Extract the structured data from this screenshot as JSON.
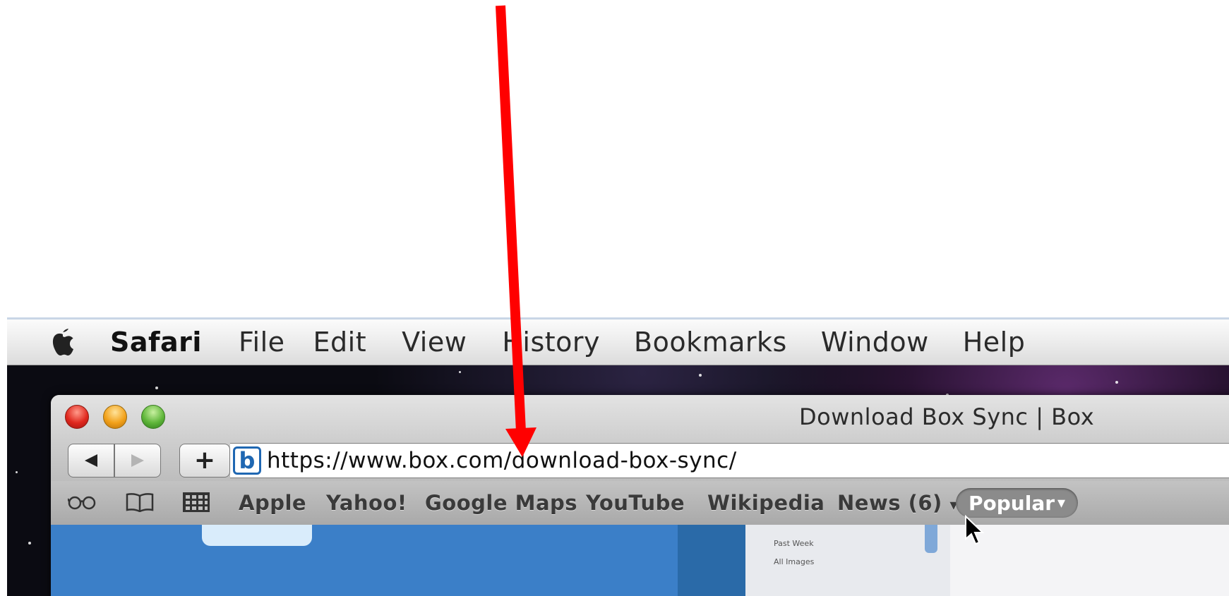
{
  "menubar": {
    "app_name": "Safari",
    "items": [
      "File",
      "Edit",
      "View",
      "History",
      "Bookmarks",
      "Window",
      "Help"
    ]
  },
  "window": {
    "title": "Download Box Sync | Box"
  },
  "toolbar": {
    "back_icon": "back-arrow-icon",
    "forward_icon": "forward-arrow-icon",
    "add_label": "+",
    "favicon_letter": "b",
    "url": "https://www.box.com/download-box-sync/"
  },
  "bookmarks": {
    "items": [
      "Apple",
      "Yahoo!",
      "Google Maps",
      "YouTube",
      "Wikipedia",
      "News (6)"
    ],
    "popular_label": "Popular",
    "dropdown_glyph": "▾"
  },
  "page_panel": {
    "rows": [
      "Past Week",
      "All Images"
    ]
  },
  "colors": {
    "annotation_arrow": "#ff0000",
    "page_blue": "#3b7fc8"
  }
}
